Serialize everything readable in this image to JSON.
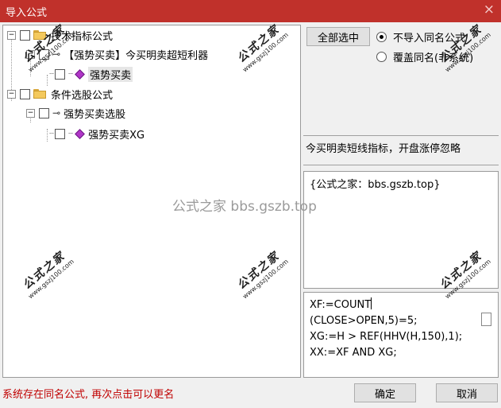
{
  "window": {
    "title": "导入公式",
    "close_icon": "×"
  },
  "tree": {
    "items": [
      {
        "label": "技术指标公式",
        "icon": "folder-icon"
      },
      {
        "label": "【强势买卖】今买明卖超短利器",
        "icon": "key-icon"
      },
      {
        "label": "强势买卖",
        "icon": "gem-icon"
      },
      {
        "label": "条件选股公式",
        "icon": "folder-icon"
      },
      {
        "label": "强势买卖选股",
        "icon": "key-icon"
      },
      {
        "label": "强势买卖XG",
        "icon": "gem-icon"
      }
    ]
  },
  "actions": {
    "select_all": "全部选中",
    "ok": "确定",
    "cancel": "取消"
  },
  "options": {
    "no_import_same_name": "不导入同名公式",
    "overwrite_same_name": "覆盖同名(非系统)",
    "selected": "no_import_same_name"
  },
  "description": "今买明卖短线指标，开盘涨停忽略",
  "author": "{公式之家：bbs.gszb.top}",
  "code": {
    "lines": [
      "XF:=COUNT",
      "(CLOSE>OPEN,5)=5;",
      "XG:=H > REF(HHV(H,150),1);",
      "XX:=XF AND XG;"
    ]
  },
  "watermark": "公式之家 bbs.gszb.top",
  "logo": {
    "name": "公式之家",
    "url": "www.gszj100.com"
  },
  "status": "系统存在同名公式, 再次点击可以更名",
  "colors": {
    "title_bar": "#c0312b",
    "status_text": "#c00000",
    "gem": "#b036c8"
  }
}
